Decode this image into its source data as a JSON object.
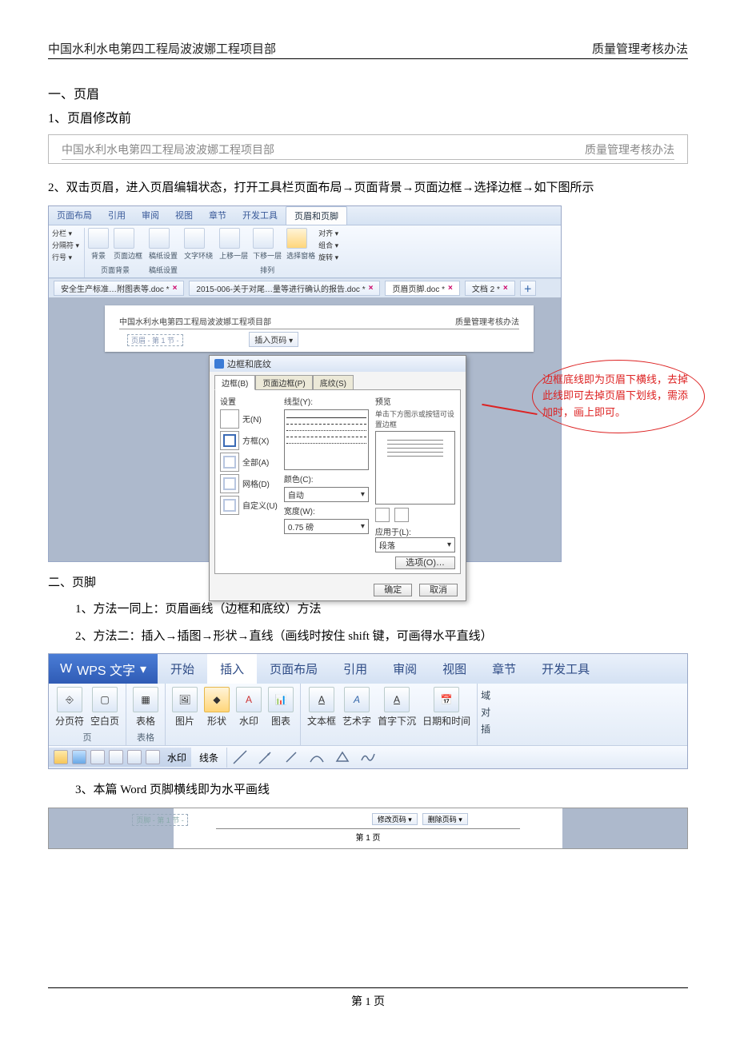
{
  "doc_header": {
    "left": "中国水利水电第四工程局波波娜工程项目部",
    "right": "质量管理考核办法"
  },
  "section1": {
    "title": "一、页眉",
    "item1": "1、页眉修改前",
    "sample_left": "中国水利水电第四工程局波波娜工程项目部",
    "sample_right": "质量管理考核办法",
    "item2": "2、双击页眉，进入页眉编辑状态，打开工具栏页面布局→页面背景→页面边框→选择边框→如下图所示"
  },
  "wps1": {
    "tabs": [
      "页面布局",
      "引用",
      "审阅",
      "视图",
      "章节",
      "开发工具",
      "页眉和页脚"
    ],
    "side": [
      "分栏 ▾",
      "分隔符 ▾",
      "行号 ▾"
    ],
    "group_labels": [
      "页面背景",
      "稿纸设置",
      "",
      "排列"
    ],
    "icons": [
      "背景",
      "页面边框",
      "稿纸设置",
      "文字环绕",
      "上移一层",
      "下移一层",
      "选择窗格"
    ],
    "rmenu": [
      "对齐 ▾",
      "组合 ▾",
      "旋转 ▾"
    ],
    "doc_tabs": [
      "安全生产标准…附图表等.doc *",
      "2015-006-关于对尾…量等进行确认的报告.doc *",
      "页眉页脚.doc *",
      "文档 2 *"
    ],
    "paper_hdr_left": "中国水利水电第四工程局波波娜工程项目部",
    "paper_hdr_right": "质量管理考核办法",
    "hdr_marker": "页眉 - 第 1 节 -",
    "insert_btn": "插入页码 ▾",
    "dialog": {
      "title": "边框和底纹",
      "tabs": [
        "边框(B)",
        "页面边框(P)",
        "底纹(S)"
      ],
      "opts_label": "设置",
      "opts": [
        "无(N)",
        "方框(X)",
        "全部(A)",
        "网格(D)",
        "自定义(U)"
      ],
      "linetype_label": "线型(Y):",
      "color_label": "颜色(C):",
      "color_val": "自动",
      "width_label": "宽度(W):",
      "width_val": "0.75 磅",
      "preview_label": "预览",
      "preview_hint": "单击下方图示或按钮可设置边框",
      "apply_label": "应用于(L):",
      "apply_val": "段落",
      "options": "选项(O)…",
      "ok": "确定",
      "cancel": "取消"
    },
    "callout": "边框底线即为页眉下横线，去掉此线即可去掉页眉下划线，需添加时，画上即可。"
  },
  "section2": {
    "title": "二、页脚",
    "m1": "1、方法一同上：页眉画线（边框和底纹）方法",
    "m2": "2、方法二：插入→插图→形状→直线（画线时按住 shift 键，可画得水平直线）"
  },
  "wps2": {
    "app": "WPS 文字",
    "tabs": [
      "开始",
      "插入",
      "页面布局",
      "引用",
      "审阅",
      "视图",
      "章节",
      "开发工具"
    ],
    "groups": [
      {
        "label": "页",
        "items": [
          "分页符",
          "空白页"
        ]
      },
      {
        "label": "表格",
        "items": [
          "表格"
        ]
      },
      {
        "label": "",
        "items": [
          "图片",
          "形状",
          "水印",
          "图表"
        ]
      },
      {
        "label": "",
        "items": [
          "文本框",
          "艺术字",
          "首字下沉",
          "日期和时间"
        ]
      }
    ],
    "side": [
      "域",
      "对",
      "插"
    ],
    "shapes_label": "线条",
    "qat_hint": "水印"
  },
  "item3": "3、本篇 Word 页脚横线即为水平画线",
  "footer_fig": {
    "marker": "页脚 - 第 1 节 -",
    "btn1": "修改页码 ▾",
    "btn2": "删除页码 ▾",
    "pg": "第 1 页"
  },
  "page_number": "第 1 页"
}
